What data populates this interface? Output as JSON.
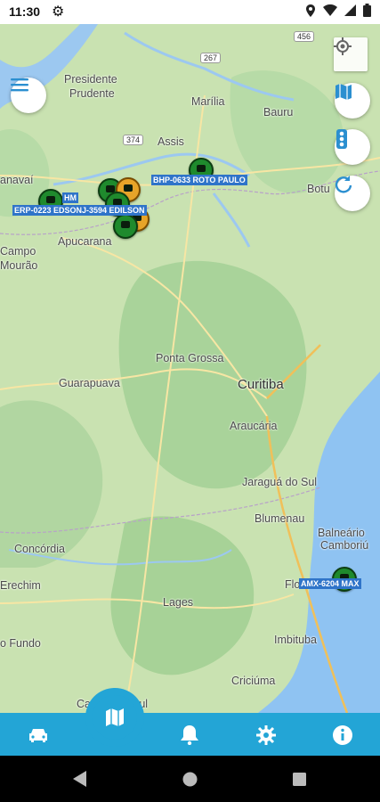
{
  "status_bar": {
    "time": "11:30"
  },
  "map": {
    "cities": [
      {
        "name": "Presidente",
        "cls": ""
      },
      {
        "name": "Prudente",
        "cls": ""
      },
      {
        "name": "Marília",
        "cls": ""
      },
      {
        "name": "Bauru",
        "cls": ""
      },
      {
        "name": "Assis",
        "cls": ""
      },
      {
        "name": "anavaí",
        "cls": ""
      },
      {
        "name": "Botu",
        "cls": ""
      },
      {
        "name": "Apucarana",
        "cls": ""
      },
      {
        "name": "Campo",
        "cls": ""
      },
      {
        "name": "Mourão",
        "cls": ""
      },
      {
        "name": "Ponta Grossa",
        "cls": ""
      },
      {
        "name": "Guarapuava",
        "cls": ""
      },
      {
        "name": "Curitiba",
        "cls": "big"
      },
      {
        "name": "Araucária",
        "cls": ""
      },
      {
        "name": "Jaraguá do Sul",
        "cls": ""
      },
      {
        "name": "Blumenau",
        "cls": ""
      },
      {
        "name": "Balneário",
        "cls": ""
      },
      {
        "name": "Camboriú",
        "cls": ""
      },
      {
        "name": "Concórdia",
        "cls": ""
      },
      {
        "name": "Erechim",
        "cls": ""
      },
      {
        "name": "Lages",
        "cls": ""
      },
      {
        "name": "Flo",
        "cls": ""
      },
      {
        "name": "Imbituba",
        "cls": ""
      },
      {
        "name": "o Fundo",
        "cls": ""
      },
      {
        "name": "Criciúma",
        "cls": ""
      },
      {
        "name": "Caxi",
        "cls": ""
      },
      {
        "name": "Sul",
        "cls": ""
      }
    ],
    "road_shields": [
      "456",
      "267",
      "374"
    ],
    "vehicles": [
      {
        "plate": "BHP-0633 ROTO PAULO",
        "status": "green"
      },
      {
        "plate": "ERP-0223 EDSONJ-3594 EDILSON",
        "status": "green"
      },
      {
        "plate": "HM",
        "status": "orange"
      },
      {
        "plate": "AMX-6204 MAX",
        "status": "green"
      }
    ]
  },
  "nav": {
    "items": [
      {
        "icon": "car-icon"
      },
      {
        "icon": "map-icon",
        "active": true
      },
      {
        "icon": "bell-icon"
      },
      {
        "icon": "gear-icon"
      },
      {
        "icon": "info-icon"
      }
    ],
    "color": "#23a5d6"
  }
}
